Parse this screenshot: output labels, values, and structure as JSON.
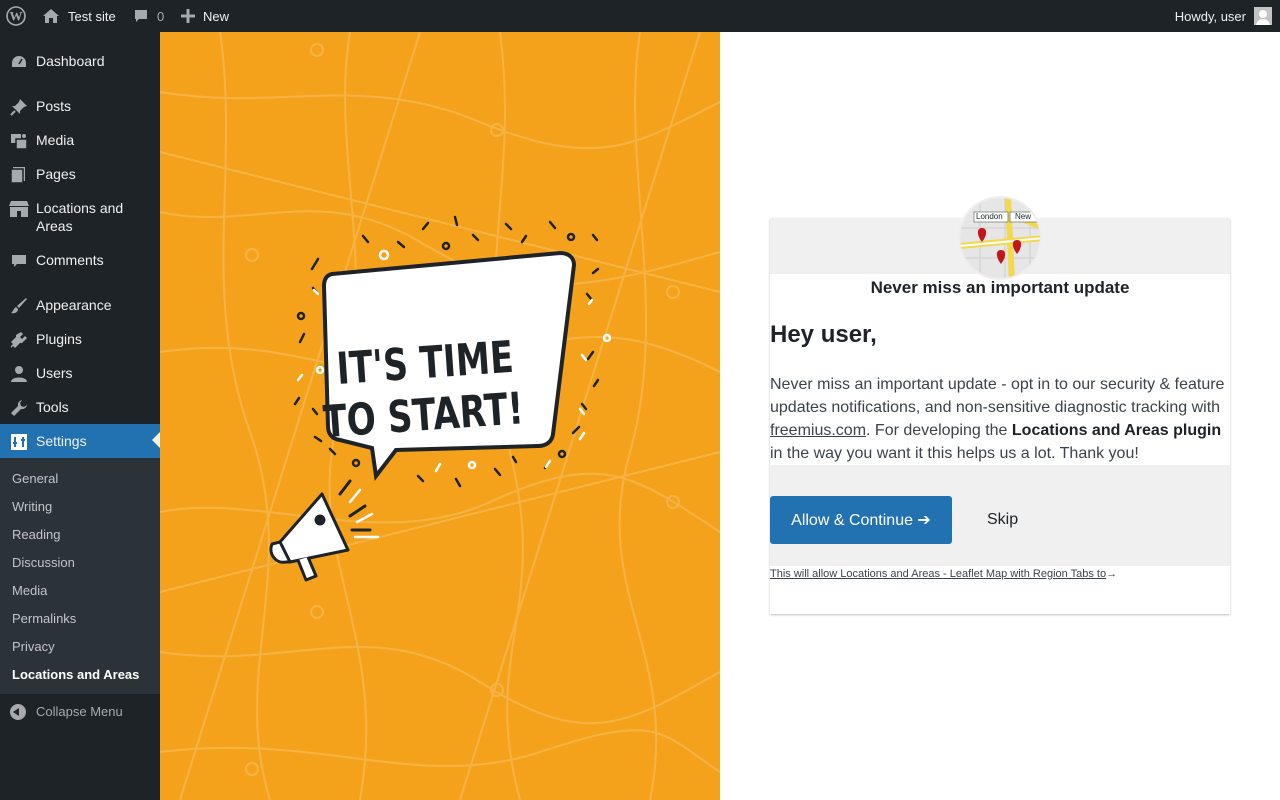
{
  "adminbar": {
    "site_name": "Test site",
    "comments_count": "0",
    "new_label": "New",
    "howdy": "Howdy, user"
  },
  "sidebar": {
    "items": [
      {
        "label": "Dashboard",
        "icon": "dashboard-icon"
      },
      {
        "label": "Posts",
        "icon": "pin-icon"
      },
      {
        "label": "Media",
        "icon": "media-icon"
      },
      {
        "label": "Pages",
        "icon": "pages-icon"
      },
      {
        "label": "Locations and Areas",
        "icon": "store-icon"
      },
      {
        "label": "Comments",
        "icon": "comment-icon"
      },
      {
        "label": "Appearance",
        "icon": "brush-icon"
      },
      {
        "label": "Plugins",
        "icon": "plugin-icon"
      },
      {
        "label": "Users",
        "icon": "user-icon"
      },
      {
        "label": "Tools",
        "icon": "wrench-icon"
      },
      {
        "label": "Settings",
        "icon": "settings-icon",
        "current": true
      }
    ],
    "submenu": [
      "General",
      "Writing",
      "Reading",
      "Discussion",
      "Media",
      "Permalinks",
      "Privacy",
      "Locations and Areas"
    ],
    "collapse_label": "Collapse Menu"
  },
  "hero": {
    "line1": "IT'S TIME",
    "line2": "TO START!",
    "background": "#f4a21b"
  },
  "optin": {
    "logo_labels": [
      "London",
      "New"
    ],
    "tagline": "Never miss an important update",
    "greeting": "Hey user,",
    "body_part1": "Never miss an important update - opt in to our security & feature updates notifications, and non-sensitive diagnostic tracking with ",
    "link": "freemius.com",
    "body_part2": ". For developing the ",
    "plugin_name": "Locations and Areas plugin",
    "body_part3": " in the way you want it this helps us a lot. Thank you!",
    "allow_label": "Allow & Continue ➔",
    "skip_label": "Skip",
    "permissions_link": "This will allow Locations and Areas - Leaflet Map with Region Tabs to",
    "permissions_arrow": "→"
  },
  "colors": {
    "admin_dark": "#1d2327",
    "accent": "#2271b1"
  }
}
